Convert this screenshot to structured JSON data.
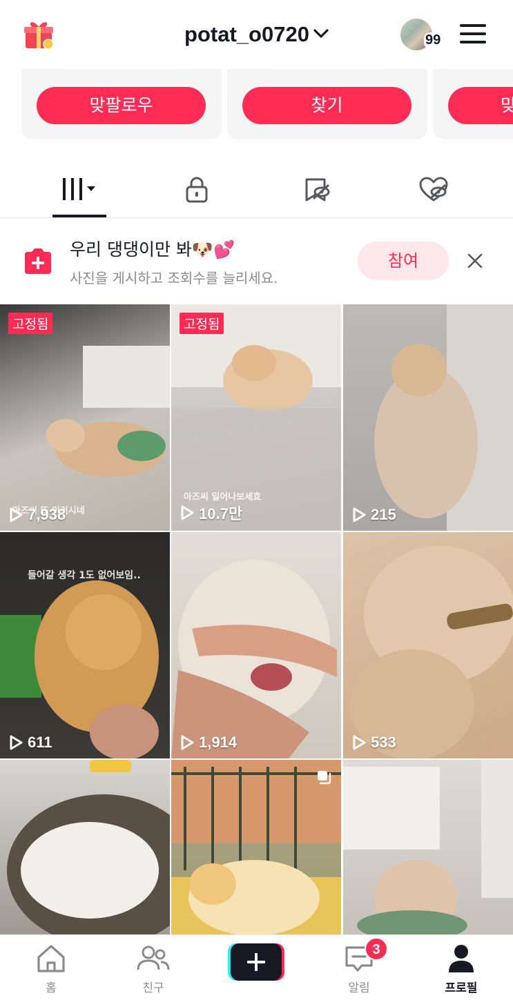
{
  "header": {
    "username": "potat_o0720",
    "avatar_count": "99"
  },
  "cards": [
    {
      "label": "맞팔로우"
    },
    {
      "label": "찾기"
    },
    {
      "label": "맞"
    }
  ],
  "tabs": [
    {
      "name": "videos",
      "icon": "grid-icon",
      "active": true
    },
    {
      "name": "private",
      "icon": "lock-icon",
      "active": false
    },
    {
      "name": "reposts",
      "icon": "repost-icon",
      "active": false
    },
    {
      "name": "liked",
      "icon": "heart-icon",
      "active": false
    }
  ],
  "banner": {
    "title": "우리 댕댕이만 봐🐶💕",
    "subtitle": "사진을 게시하고 조회수를 늘리세요.",
    "join_label": "참여"
  },
  "grid": [
    {
      "pinned": "고정됨",
      "views": "7,938",
      "caption": "아즈씨 또 이러시네"
    },
    {
      "pinned": "고정됨",
      "views": "10.7만",
      "caption": "아즈씨 일어나보세효"
    },
    {
      "views": "215"
    },
    {
      "views": "611",
      "caption": "들어갈 생각 1도 없어보임.."
    },
    {
      "views": "1,914"
    },
    {
      "views": "533"
    },
    {},
    {},
    {}
  ],
  "nav": {
    "home": "홈",
    "friends": "친구",
    "inbox": "알림",
    "inbox_badge": "3",
    "profile": "프로필"
  },
  "colors": {
    "brand": "#fe2c55",
    "text": "#161823",
    "muted": "#8a8b91"
  }
}
